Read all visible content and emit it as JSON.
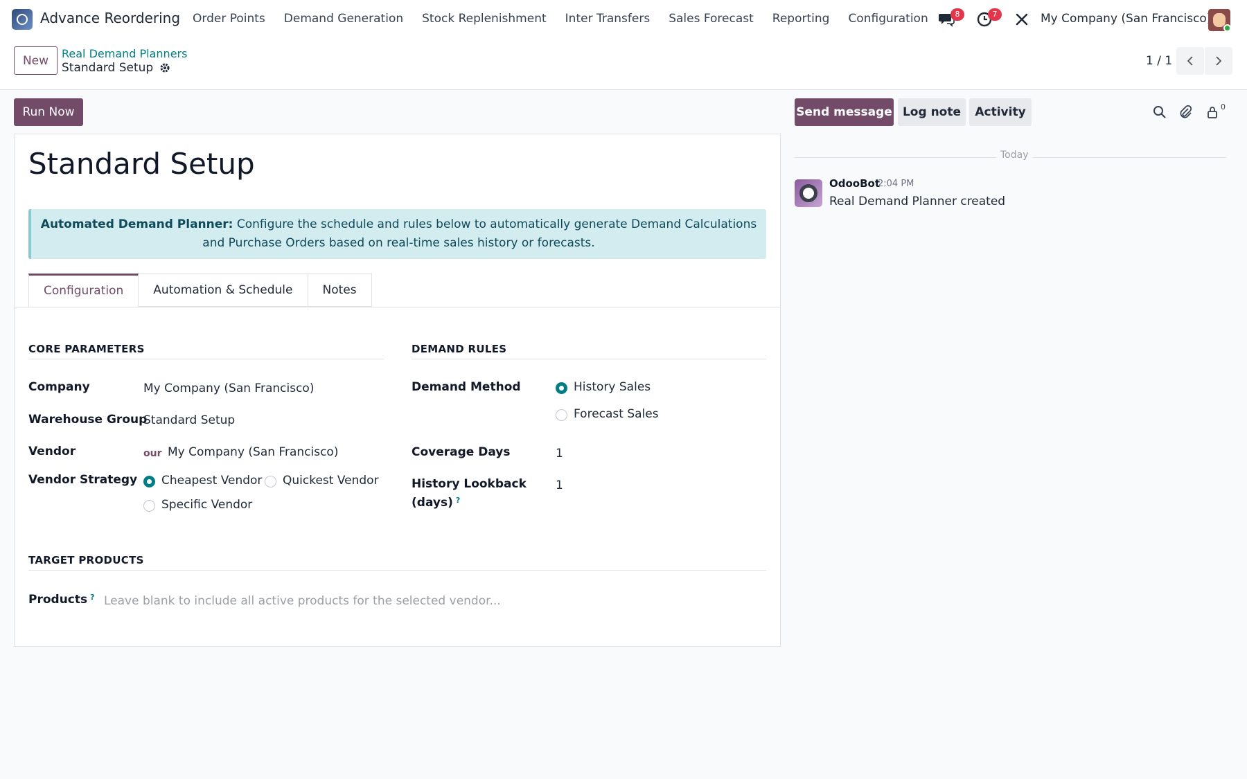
{
  "app": {
    "title": "Advance Reordering"
  },
  "menu": [
    "Order Points",
    "Demand Generation",
    "Stock Replenishment",
    "Inter Transfers",
    "Sales Forecast",
    "Reporting",
    "Configuration"
  ],
  "systray": {
    "messages_count": "8",
    "activities_count": "7",
    "company": "My Company (San Francisco)"
  },
  "control_panel": {
    "new_label": "New",
    "breadcrumb_parent": "Real Demand Planners",
    "breadcrumb_current": "Standard Setup",
    "pager": "1 / 1"
  },
  "form": {
    "run_now_label": "Run Now",
    "title": "Standard Setup",
    "alert_bold": "Automated Demand Planner:",
    "alert_text": " Configure the schedule and rules below to automatically generate Demand Calculations and Purchase Orders based on real-time sales history or forecasts.",
    "tabs": [
      "Configuration",
      "Automation & Schedule",
      "Notes"
    ],
    "core": {
      "heading": "CORE PARAMETERS",
      "company_label": "Company",
      "company_value": "My Company (San Francisco)",
      "warehouse_group_label": "Warehouse Group",
      "warehouse_group_value": "Standard Setup",
      "vendor_label": "Vendor",
      "vendor_tag": "our",
      "vendor_value": "My Company (San Francisco)",
      "vendor_strategy_label": "Vendor Strategy",
      "strategy_options": [
        "Cheapest Vendor",
        "Quickest Vendor",
        "Specific Vendor"
      ],
      "strategy_selected": "Cheapest Vendor"
    },
    "demand": {
      "heading": "DEMAND RULES",
      "method_label": "Demand Method",
      "method_options": [
        "History Sales",
        "Forecast Sales"
      ],
      "method_selected": "History Sales",
      "coverage_label": "Coverage Days",
      "coverage_value": "1",
      "lookback_label_1": "History Lookback",
      "lookback_label_2": "(days)",
      "lookback_value": "1",
      "help_mark": "?"
    },
    "target": {
      "heading": "TARGET PRODUCTS",
      "products_label": "Products",
      "products_placeholder": "Leave blank to include all active products for the selected vendor..."
    }
  },
  "chatter": {
    "send_message_label": "Send message",
    "log_note_label": "Log note",
    "activity_label": "Activity",
    "followers_count": "0",
    "date_separator": "Today",
    "message": {
      "author": "OdooBot",
      "time": "2:04 PM",
      "body": "Real Demand Planner created"
    }
  },
  "colors": {
    "brand": "#714b67",
    "teal": "#017e84",
    "alert_bg": "#d3ecf0",
    "badge": "#e1364b"
  }
}
